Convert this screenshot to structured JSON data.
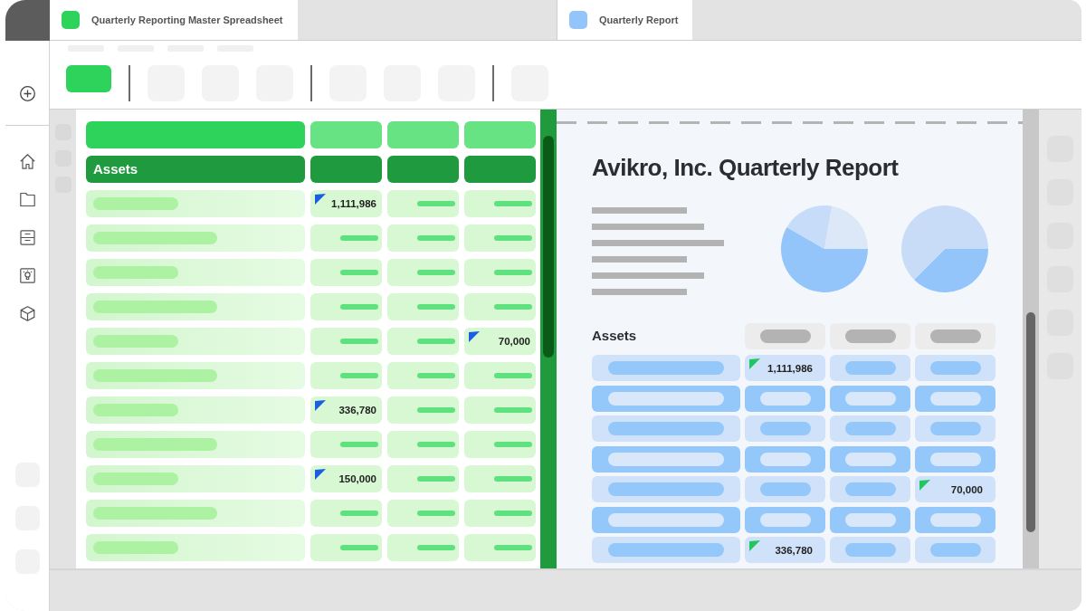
{
  "tabs": [
    {
      "title": "Quarterly Reporting Master Spreadsheet",
      "color": "#2dd35a"
    },
    {
      "title": "Quarterly Report",
      "color": "#93c5fb"
    }
  ],
  "spreadsheet": {
    "section_label": "Assets",
    "rows": [
      {
        "cells": [
          {
            "kind": "placeholder"
          },
          {
            "kind": "value",
            "text": "1,111,986"
          },
          {
            "kind": "placeholder"
          },
          {
            "kind": "placeholder"
          }
        ]
      },
      {
        "cells": [
          {
            "kind": "placeholder"
          },
          {
            "kind": "placeholder"
          },
          {
            "kind": "placeholder"
          },
          {
            "kind": "placeholder"
          }
        ]
      },
      {
        "cells": [
          {
            "kind": "placeholder"
          },
          {
            "kind": "placeholder"
          },
          {
            "kind": "placeholder"
          },
          {
            "kind": "placeholder"
          }
        ]
      },
      {
        "cells": [
          {
            "kind": "placeholder"
          },
          {
            "kind": "placeholder"
          },
          {
            "kind": "placeholder"
          },
          {
            "kind": "placeholder"
          }
        ]
      },
      {
        "cells": [
          {
            "kind": "placeholder"
          },
          {
            "kind": "placeholder"
          },
          {
            "kind": "placeholder"
          },
          {
            "kind": "value",
            "text": "70,000"
          }
        ]
      },
      {
        "cells": [
          {
            "kind": "placeholder"
          },
          {
            "kind": "placeholder"
          },
          {
            "kind": "placeholder"
          },
          {
            "kind": "placeholder"
          }
        ]
      },
      {
        "cells": [
          {
            "kind": "placeholder"
          },
          {
            "kind": "value",
            "text": "336,780"
          },
          {
            "kind": "placeholder"
          },
          {
            "kind": "placeholder"
          }
        ]
      },
      {
        "cells": [
          {
            "kind": "placeholder"
          },
          {
            "kind": "placeholder"
          },
          {
            "kind": "placeholder"
          },
          {
            "kind": "placeholder"
          }
        ]
      },
      {
        "cells": [
          {
            "kind": "placeholder"
          },
          {
            "kind": "value",
            "text": "150,000"
          },
          {
            "kind": "placeholder"
          },
          {
            "kind": "placeholder"
          }
        ]
      },
      {
        "cells": [
          {
            "kind": "placeholder"
          },
          {
            "kind": "placeholder"
          },
          {
            "kind": "placeholder"
          },
          {
            "kind": "placeholder"
          }
        ]
      },
      {
        "cells": [
          {
            "kind": "placeholder"
          },
          {
            "kind": "placeholder"
          },
          {
            "kind": "placeholder"
          },
          {
            "kind": "placeholder"
          }
        ]
      }
    ]
  },
  "report": {
    "title": "Avikro, Inc. Quarterly Report",
    "table": {
      "label": "Assets",
      "rows": [
        {
          "highlighted": false,
          "cells": [
            {
              "kind": "placeholder"
            },
            {
              "kind": "value",
              "text": "1,111,986"
            },
            {
              "kind": "placeholder"
            },
            {
              "kind": "placeholder"
            }
          ]
        },
        {
          "highlighted": true,
          "cells": [
            {
              "kind": "placeholder"
            },
            {
              "kind": "placeholder"
            },
            {
              "kind": "placeholder"
            },
            {
              "kind": "placeholder"
            }
          ]
        },
        {
          "highlighted": false,
          "cells": [
            {
              "kind": "placeholder"
            },
            {
              "kind": "placeholder"
            },
            {
              "kind": "placeholder"
            },
            {
              "kind": "placeholder"
            }
          ]
        },
        {
          "highlighted": true,
          "cells": [
            {
              "kind": "placeholder"
            },
            {
              "kind": "placeholder"
            },
            {
              "kind": "placeholder"
            },
            {
              "kind": "placeholder"
            }
          ]
        },
        {
          "highlighted": false,
          "cells": [
            {
              "kind": "placeholder"
            },
            {
              "kind": "placeholder"
            },
            {
              "kind": "placeholder"
            },
            {
              "kind": "value",
              "text": "70,000"
            }
          ]
        },
        {
          "highlighted": true,
          "cells": [
            {
              "kind": "placeholder"
            },
            {
              "kind": "placeholder"
            },
            {
              "kind": "placeholder"
            },
            {
              "kind": "placeholder"
            }
          ]
        },
        {
          "highlighted": false,
          "cells": [
            {
              "kind": "placeholder"
            },
            {
              "kind": "value",
              "text": "336,780"
            },
            {
              "kind": "placeholder"
            },
            {
              "kind": "placeholder"
            }
          ]
        }
      ]
    }
  }
}
